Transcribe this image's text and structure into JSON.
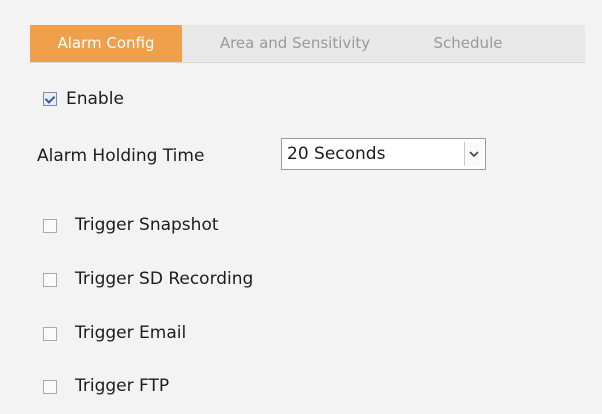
{
  "tabs": [
    {
      "label": "Alarm Config",
      "active": true
    },
    {
      "label": "Area and Sensitivity",
      "active": false
    },
    {
      "label": "Schedule",
      "active": false
    }
  ],
  "enable": {
    "label": "Enable",
    "checked": true
  },
  "holding_time": {
    "label": "Alarm Holding Time",
    "value": "20 Seconds"
  },
  "triggers": [
    {
      "label": "Trigger Snapshot",
      "checked": false
    },
    {
      "label": "Trigger SD Recording",
      "checked": false
    },
    {
      "label": "Trigger Email",
      "checked": false
    },
    {
      "label": "Trigger FTP",
      "checked": false
    }
  ],
  "colors": {
    "active_tab": "#f0a04b",
    "inactive_tab_text": "#9a9a9a",
    "background": "#f3f3f3"
  }
}
